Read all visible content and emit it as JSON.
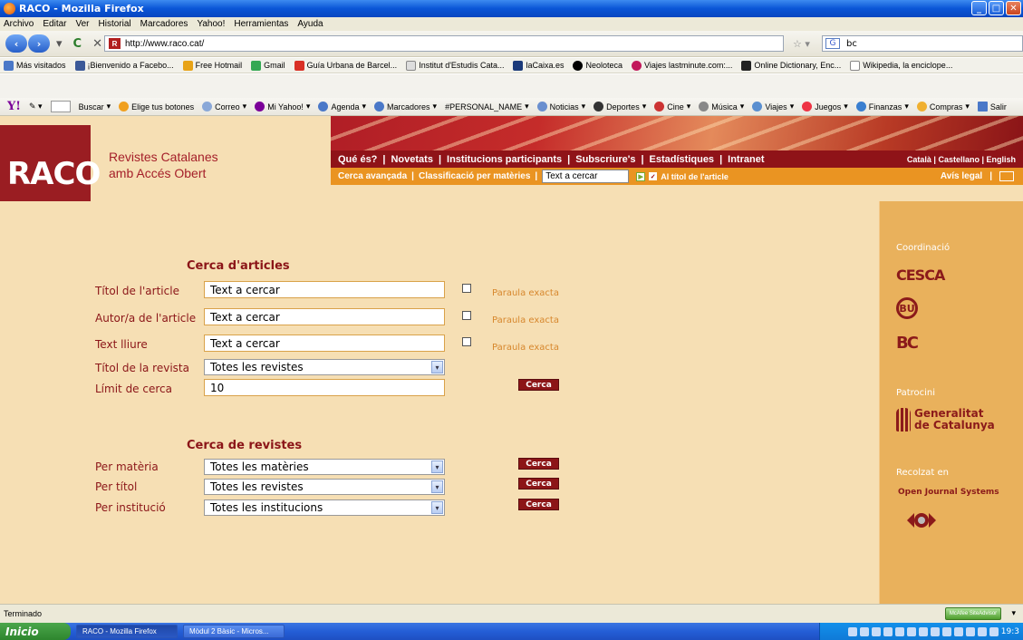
{
  "window": {
    "title": "RACO - Mozilla Firefox"
  },
  "menu": [
    "Archivo",
    "Editar",
    "Ver",
    "Historial",
    "Marcadores",
    "Yahoo!",
    "Herramientas",
    "Ayuda"
  ],
  "nav": {
    "url": "http://www.raco.cat/",
    "search_value": "bc"
  },
  "bookmarks": [
    "Más visitados",
    "¡Bienvenido a Facebo...",
    "Free Hotmail",
    "Gmail",
    "Guía Urbana de Barcel...",
    "Institut d'Estudis Cata...",
    "laCaixa.es",
    "Neoloteca",
    "Viajes lastminute.com:...",
    "Online Dictionary, Enc...",
    "Wikipedia, la enciclope..."
  ],
  "yahoo": [
    "Buscar",
    "Elige tus botones",
    "Correo",
    "Mi Yahoo!",
    "Agenda",
    "Marcadores",
    "#PERSONAL_NAME",
    "Noticias",
    "Deportes",
    "Cine",
    "Música",
    "Viajes",
    "Juegos",
    "Finanzas",
    "Compras",
    "Salir"
  ],
  "site": {
    "logo": "RACO",
    "tagline1": "Revistes Catalanes",
    "tagline2": "amb Accés Obert",
    "nav1": [
      "Qué és?",
      "Novetats",
      "Institucions participants",
      "Subscriure's",
      "Estadístiques",
      "Intranet"
    ],
    "languages": "Català | Castellano | English",
    "nav2": [
      "Cerca avançada",
      "Classificació per matèries"
    ],
    "quick_search_placeholder": "Text a cercar",
    "title_only": "Al títol de l'article",
    "legal": "Avís legal"
  },
  "sidebar": {
    "coord_label": "Coordinació",
    "coord_logos": [
      "CESCA",
      "BU",
      "BC"
    ],
    "patrocini_label": "Patrocini",
    "gen1": "Generalitat",
    "gen2": "de Catalunya",
    "recolzat_label": "Recolzat en",
    "ojs": "Open Journal Systems"
  },
  "articles": {
    "heading": "Cerca d'articles",
    "title_label": "Títol de l'article",
    "author_label": "Autor/a de l'article",
    "free_label": "Text lliure",
    "journal_label": "Títol de la revista",
    "limit_label": "Límit de cerca",
    "input_value": "Text a cercar",
    "exact": "Paraula exacta",
    "journal_value": "Totes les revistes",
    "limit_value": "10",
    "button": "Cerca"
  },
  "journals": {
    "heading": "Cerca de revistes",
    "subject_label": "Per matèria",
    "title_label": "Per títol",
    "inst_label": "Per institució",
    "subject_value": "Totes les matèries",
    "title_value": "Totes les revistes",
    "inst_value": "Totes les institucions",
    "button": "Cerca"
  },
  "status": {
    "text": "Terminado",
    "mcafee": "McAfee SiteAdvisor"
  },
  "taskbar": {
    "start": "Inicio",
    "task1": "RACO - Mozilla Firefox",
    "task2": "Mòdul 2 Bàsic - Micros...",
    "clock": "19:3"
  }
}
